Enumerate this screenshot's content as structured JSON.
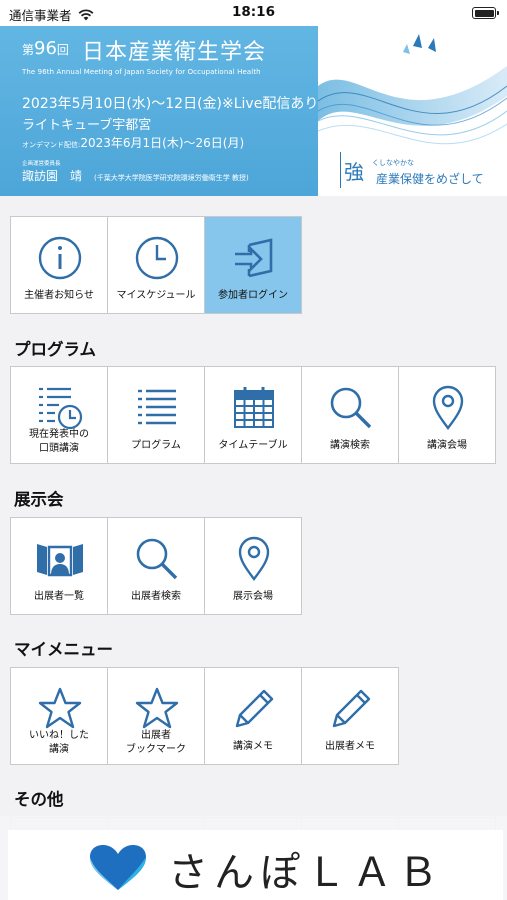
{
  "status": {
    "carrier": "通信事業者",
    "time": "18:16"
  },
  "banner": {
    "edition_prefix": "第",
    "edition_num": "96",
    "edition_suffix": "回",
    "title": "日本産業衛生学会",
    "subtitle_en": "The 96th Annual Meeting of Japan Society for Occupational Health",
    "date": "2023年5月10日(水)～12日(金)※Live配信あり",
    "venue": "ライトキューブ宇都宮",
    "ondemand_label": "オンデマンド配信:",
    "ondemand_dates": "2023年6月1日(木)～26日(月)",
    "chair_role": "企画運営委員長",
    "chair_name": "諏訪園　靖",
    "chair_affil": "(千葉大学大学院医学研究院環境労働衛生学 教授)",
    "slogan_big": "強",
    "slogan_small1": "くしなやかな",
    "slogan_small2": "産業保健をめざして"
  },
  "top_menu": [
    {
      "label": "主催者お知らせ",
      "icon": "info-icon",
      "active": false
    },
    {
      "label": "マイスケジュール",
      "icon": "clock-icon",
      "active": false
    },
    {
      "label": "参加者ログイン",
      "icon": "login-icon",
      "active": true
    }
  ],
  "sections": {
    "program": {
      "title": "プログラム",
      "items": [
        {
          "label": "現在発表中の\n口頭講演",
          "icon": "list-clock-icon"
        },
        {
          "label": "プログラム",
          "icon": "list-icon"
        },
        {
          "label": "タイムテーブル",
          "icon": "calendar-icon"
        },
        {
          "label": "講演検索",
          "icon": "search-icon"
        },
        {
          "label": "講演会場",
          "icon": "map-pin-icon"
        }
      ]
    },
    "exhibition": {
      "title": "展示会",
      "items": [
        {
          "label": "出展者一覧",
          "icon": "exhibitor-icon"
        },
        {
          "label": "出展者検索",
          "icon": "search-icon"
        },
        {
          "label": "展示会場",
          "icon": "map-pin-icon"
        }
      ]
    },
    "mymenu": {
      "title": "マイメニュー",
      "items": [
        {
          "label": "いいね！した\n講演",
          "icon": "star-icon"
        },
        {
          "label": "出展者\nブックマーク",
          "icon": "star-icon"
        },
        {
          "label": "講演メモ",
          "icon": "pencil-icon"
        },
        {
          "label": "出展者メモ",
          "icon": "pencil-icon"
        }
      ]
    },
    "other": {
      "title": "その他"
    }
  },
  "footer": {
    "brand": "さんぽＬＡＢ",
    "logo": "heart-icon"
  },
  "colors": {
    "accent": "#2f6ea8",
    "active_tile": "#86c6ec",
    "banner": "#5aaedc"
  }
}
